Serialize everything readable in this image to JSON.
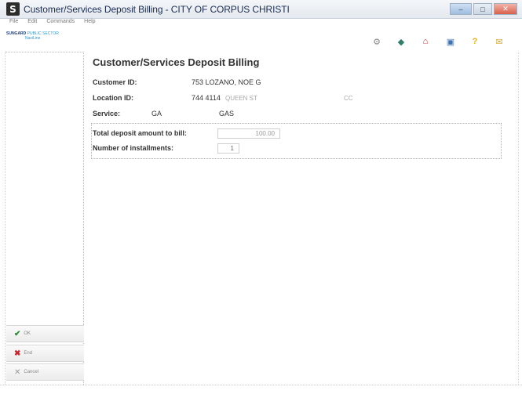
{
  "window": {
    "app_letter": "S",
    "title": "Customer/Services Deposit Billing - CITY OF CORPUS CHRISTI"
  },
  "menu": [
    "File",
    "Edit",
    "Commands",
    "Help"
  ],
  "brand": {
    "line1": "SUNGARD",
    "line2": "PUBLIC SECTOR",
    "line3": "NaviLine"
  },
  "toolbar": {
    "icons": [
      "gear-icon",
      "refresh-icon",
      "home-icon",
      "print-icon",
      "help-icon",
      "mail-icon"
    ]
  },
  "sidebar": {
    "ok_label": "OK",
    "end_label": "End",
    "cancel_label": "Cancel"
  },
  "form": {
    "title": "Customer/Services Deposit Billing",
    "customer_label": "Customer ID:",
    "customer_value": "753 LOZANO, NOE G",
    "location_label": "Location ID:",
    "location_value": "744 4114",
    "location_street": "QUEEN ST",
    "location_suffix": "CC",
    "service_label": "Service:",
    "service_code": "GA",
    "service_name": "GAS",
    "deposit_label": "Total deposit amount to bill:",
    "deposit_value": "100.00",
    "installments_label": "Number of installments:",
    "installments_value": "1"
  }
}
